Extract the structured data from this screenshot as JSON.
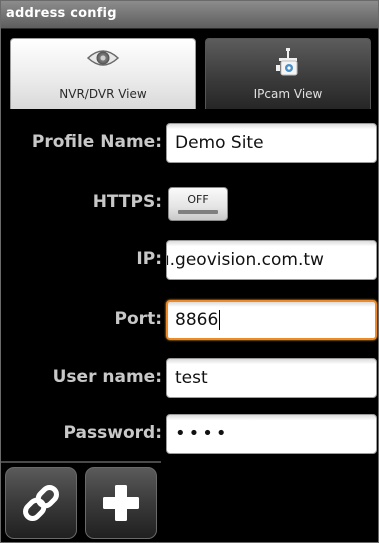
{
  "window": {
    "title": "address config"
  },
  "tabs": [
    {
      "label": "NVR/DVR View",
      "icon": "eye-icon",
      "selected": true
    },
    {
      "label": "IPcam View",
      "icon": "ip-camera-icon",
      "selected": false
    }
  ],
  "form": {
    "profile_name": {
      "label": "Profile Name:",
      "value": "Demo Site"
    },
    "https": {
      "label": "HTTPS:",
      "toggle_text": "OFF",
      "state": "off"
    },
    "ip": {
      "label": "IP:",
      "value": "ו.geovision.com.tw"
    },
    "port": {
      "label": "Port:",
      "value": "8866",
      "focused": true
    },
    "user_name": {
      "label": "User name:",
      "value": "test"
    },
    "password": {
      "label": "Password:",
      "value_masked": "••••"
    }
  },
  "toolbar": {
    "buttons": [
      {
        "icon": "link-icon"
      },
      {
        "icon": "plus-icon"
      }
    ]
  },
  "colors": {
    "focus_accent": "#f08a24",
    "background": "#000000",
    "label_text": "#c8c8c8"
  }
}
